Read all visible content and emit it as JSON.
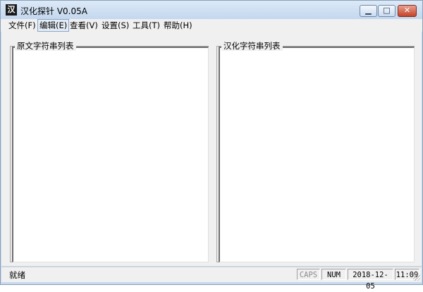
{
  "window": {
    "title": "汉化探针  V0.05A",
    "icon": "app-logo-icon",
    "controls": {
      "minimize": "minimize-icon",
      "maximize": "maximize-icon",
      "close": "close-icon"
    }
  },
  "menu": {
    "items": [
      {
        "label": "文件(F)"
      },
      {
        "label": "编辑(E)"
      },
      {
        "label": "查看(V)"
      },
      {
        "label": "设置(S)"
      },
      {
        "label": "工具(T)"
      },
      {
        "label": "帮助(H)"
      }
    ],
    "active": "编辑(E)"
  },
  "panels": {
    "left": {
      "label": "原文字符串列表"
    },
    "right": {
      "label": "汉化字符串列表"
    }
  },
  "status": {
    "text": "就绪",
    "caps": "CAPS",
    "num": "NUM",
    "date": "2018-12-05",
    "time": "11:09"
  },
  "colors": {
    "titlebar": "#c3d7ee",
    "close_button": "#c4422a",
    "face": "#f0f0f0"
  }
}
